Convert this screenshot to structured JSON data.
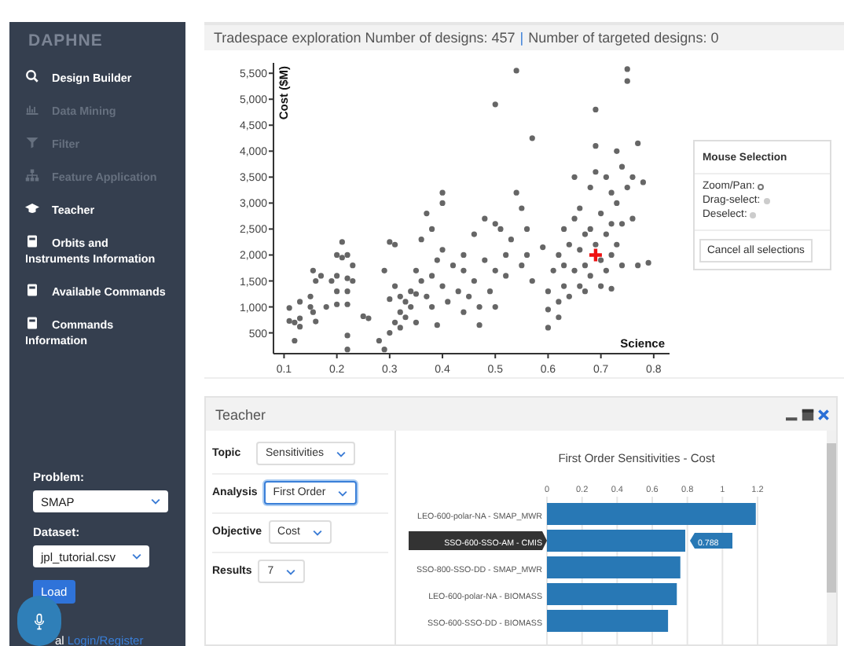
{
  "sidebar": {
    "brand": "DAPHNE",
    "items": [
      {
        "label": "Design Builder",
        "disabled": false
      },
      {
        "label": "Data Mining",
        "disabled": true
      },
      {
        "label": "Filter",
        "disabled": true
      },
      {
        "label": "Feature Application",
        "disabled": true
      },
      {
        "label": "Teacher",
        "disabled": false
      },
      {
        "label": "Orbits and Instruments Information",
        "disabled": false
      },
      {
        "label": "Available Commands",
        "disabled": false
      },
      {
        "label": "Commands Information",
        "disabled": false
      }
    ],
    "problem_label": "Problem:",
    "problem": "SMAP",
    "dataset_label": "Dataset:",
    "dataset": "jpl_tutorial.csv",
    "load_button": "Load",
    "login_prefix": "al",
    "login_link": "Login/Register"
  },
  "tradespace": {
    "title": "Tradespace exploration Number of designs: 457",
    "separator": "|",
    "targeted": "Number of targeted designs: 0",
    "chart_data": {
      "type": "scatter",
      "xlabel": "Science",
      "ylabel": "Cost ($M)",
      "xlim": [
        0.08,
        0.83
      ],
      "ylim": [
        100,
        5700
      ],
      "xticks": [
        0.1,
        0.2,
        0.3,
        0.4,
        0.5,
        0.6,
        0.7,
        0.8
      ],
      "yticks": [
        {
          "value": 500,
          "label": "500"
        },
        {
          "value": 1000,
          "label": "1,000"
        },
        {
          "value": 1500,
          "label": "1,500"
        },
        {
          "value": 2000,
          "label": "2,000"
        },
        {
          "value": 2500,
          "label": "2,500"
        },
        {
          "value": 3000,
          "label": "3,000"
        },
        {
          "value": 3500,
          "label": "3,500"
        },
        {
          "value": 4000,
          "label": "4,000"
        },
        {
          "value": 4500,
          "label": "4,500"
        },
        {
          "value": 5000,
          "label": "5,000"
        },
        {
          "value": 5500,
          "label": "5,500"
        }
      ],
      "x": [
        0.69,
        0.11,
        0.11,
        0.12,
        0.12,
        0.13,
        0.13,
        0.13,
        0.15,
        0.15,
        0.155,
        0.155,
        0.16,
        0.16,
        0.17,
        0.18,
        0.19,
        0.2,
        0.2,
        0.2,
        0.2,
        0.21,
        0.21,
        0.22,
        0.22,
        0.22,
        0.22,
        0.22,
        0.22,
        0.23,
        0.23,
        0.25,
        0.26,
        0.28,
        0.29,
        0.29,
        0.3,
        0.3,
        0.3,
        0.31,
        0.31,
        0.31,
        0.32,
        0.32,
        0.32,
        0.33,
        0.33,
        0.34,
        0.34,
        0.35,
        0.35,
        0.35,
        0.36,
        0.36,
        0.37,
        0.37,
        0.38,
        0.38,
        0.38,
        0.39,
        0.39,
        0.4,
        0.4,
        0.4,
        0.4,
        0.41,
        0.42,
        0.43,
        0.44,
        0.44,
        0.44,
        0.45,
        0.46,
        0.46,
        0.47,
        0.47,
        0.48,
        0.48,
        0.49,
        0.5,
        0.5,
        0.5,
        0.5,
        0.51,
        0.52,
        0.52,
        0.53,
        0.54,
        0.54,
        0.55,
        0.55,
        0.56,
        0.56,
        0.57,
        0.57,
        0.59,
        0.6,
        0.6,
        0.6,
        0.61,
        0.62,
        0.62,
        0.62,
        0.63,
        0.63,
        0.63,
        0.64,
        0.64,
        0.65,
        0.65,
        0.65,
        0.66,
        0.66,
        0.66,
        0.67,
        0.67,
        0.67,
        0.68,
        0.68,
        0.68,
        0.69,
        0.69,
        0.69,
        0.69,
        0.7,
        0.7,
        0.7,
        0.71,
        0.71,
        0.71,
        0.72,
        0.72,
        0.72,
        0.72,
        0.73,
        0.73,
        0.73,
        0.74,
        0.74,
        0.74,
        0.75,
        0.75,
        0.75,
        0.76,
        0.76,
        0.77,
        0.77,
        0.78,
        0.79
      ],
      "series": [
        {
          "color": "#666666",
          "values": [
            null,
            980,
            730,
            700,
            350,
            1100,
            780,
            620,
            1200,
            1000,
            1700,
            900,
            1500,
            720,
            1600,
            1000,
            1500,
            2000,
            1600,
            1300,
            1050,
            2250,
            1950,
            2000,
            1550,
            1300,
            1050,
            450,
            180,
            1800,
            1500,
            820,
            780,
            350,
            1700,
            180,
            2250,
            1150,
            500,
            2200,
            1400,
            700,
            1200,
            900,
            600,
            1100,
            800,
            1300,
            1000,
            1700,
            1250,
            700,
            2300,
            1500,
            2800,
            1200,
            2500,
            1600,
            1000,
            650,
            1900,
            3200,
            3000,
            2100,
            1400,
            1100,
            1800,
            1300,
            2000,
            1700,
            900,
            1200,
            2400,
            1500,
            1000,
            650,
            2700,
            1900,
            1300,
            2600,
            1700,
            1000,
            4900,
            2500,
            2000,
            1600,
            2300,
            5550,
            3200,
            2900,
            1800,
            2500,
            2000,
            4250,
            1500,
            2150,
            1300,
            950,
            600,
            1700,
            2000,
            1100,
            800,
            2500,
            1800,
            1400,
            2200,
            1200,
            3500,
            2700,
            1700,
            2900,
            2100,
            1400,
            2400,
            1800,
            1300,
            3300,
            2500,
            1600,
            4800,
            4100,
            3600,
            2200,
            2800,
            1900,
            1400,
            3500,
            2400,
            1700,
            3200,
            2600,
            2000,
            1350,
            4000,
            3000,
            2200,
            3700,
            2600,
            1800,
            5350,
            5580,
            3300,
            3500,
            2700,
            4150,
            1800,
            3400,
            1850
          ]
        },
        {
          "color": "#ee1111",
          "values": [
            2000,
            null,
            null,
            null,
            null,
            null,
            null,
            null,
            null,
            null,
            null,
            null,
            null,
            null,
            null,
            null,
            null,
            null,
            null,
            null,
            null,
            null,
            null,
            null,
            null,
            null,
            null,
            null,
            null,
            null,
            null,
            null,
            null,
            null,
            null,
            null,
            null,
            null,
            null,
            null,
            null,
            null,
            null,
            null,
            null,
            null,
            null,
            null,
            null,
            null,
            null,
            null,
            null,
            null,
            null,
            null,
            null,
            null,
            null,
            null,
            null,
            null,
            null,
            null,
            null,
            null,
            null,
            null,
            null,
            null,
            null,
            null,
            null,
            null,
            null,
            null,
            null,
            null,
            null,
            null,
            null,
            null,
            null,
            null,
            null,
            null,
            null,
            null,
            null,
            null,
            null,
            null,
            null,
            null,
            null,
            null,
            null,
            null,
            null,
            null,
            null,
            null,
            null,
            null,
            null,
            null,
            null,
            null,
            null,
            null,
            null,
            null,
            null,
            null,
            null,
            null,
            null,
            null,
            null,
            null,
            null,
            null,
            null,
            null,
            null,
            null,
            null,
            null,
            null,
            null,
            null,
            null,
            null,
            null,
            null,
            null,
            null,
            null,
            null,
            null,
            null,
            null,
            null,
            null,
            null,
            null,
            null,
            null,
            null
          ]
        }
      ]
    },
    "mouse_selection": {
      "title": "Mouse Selection",
      "options": [
        {
          "label": "Zoom/Pan:",
          "selected": true
        },
        {
          "label": "Drag-select:",
          "selected": false
        },
        {
          "label": "Deselect:",
          "selected": false
        }
      ],
      "cancel_button": "Cancel all selections"
    }
  },
  "teacher": {
    "title": "Teacher",
    "fields": [
      {
        "label": "Topic",
        "value": "Sensitivities",
        "focused": false
      },
      {
        "label": "Analysis",
        "value": "First Order",
        "focused": true
      },
      {
        "label": "Objective",
        "value": "Cost",
        "focused": false
      },
      {
        "label": "Results",
        "value": "7",
        "focused": false
      }
    ],
    "chart_data": {
      "type": "bar",
      "orientation": "horizontal",
      "title": "First Order Sensitivities - Cost",
      "xticks": [
        {
          "value": 0,
          "label": "0"
        },
        {
          "value": 0.2,
          "label": "0.2"
        },
        {
          "value": 0.4,
          "label": "0.4"
        },
        {
          "value": 0.6,
          "label": "0.6"
        },
        {
          "value": 0.8,
          "label": "0.8"
        },
        {
          "value": 1,
          "label": "1"
        },
        {
          "value": 1.2,
          "label": "1.2"
        }
      ],
      "xlim": [
        0,
        1.2
      ],
      "categories": [
        "LEO-600-polar-NA - SMAP_MWR",
        "SSO-600-SSO-AM - CMIS",
        "SSO-800-SSO-DD - SMAP_MWR",
        "LEO-600-polar-NA - BIOMASS",
        "SSO-600-SSO-DD - BIOMASS"
      ],
      "grid": true,
      "series": [
        {
          "color": "#2878b5",
          "values": [
            1.19,
            0.788,
            0.76,
            0.74,
            0.69
          ]
        }
      ],
      "annotations": [
        {
          "y": "SSO-600-SSO-AM - CMIS",
          "text": "0.788"
        }
      ]
    }
  }
}
